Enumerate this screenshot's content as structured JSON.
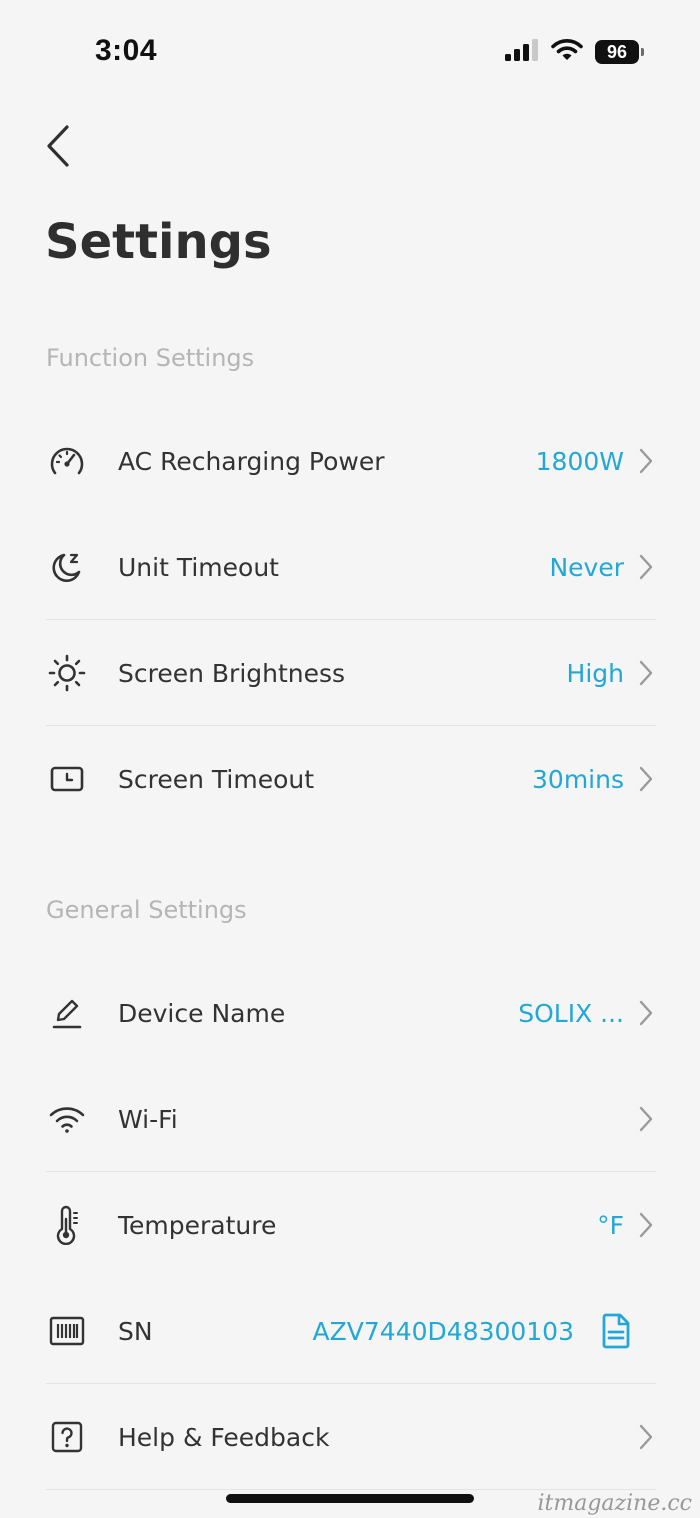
{
  "status_bar": {
    "time": "3:04",
    "battery_level": "96",
    "icons": [
      "cellular-signal-icon",
      "wifi-icon",
      "battery-icon"
    ]
  },
  "navigation": {
    "back_icon": "chevron-left-icon"
  },
  "page": {
    "title": "Settings"
  },
  "function_settings": {
    "header": "Function Settings",
    "items": [
      {
        "icon": "speedometer-icon",
        "label": "AC Recharging Power",
        "value": "1800W"
      },
      {
        "icon": "moon-sleep-icon",
        "label": "Unit Timeout",
        "value": "Never"
      },
      {
        "icon": "sun-brightness-icon",
        "label": "Screen Brightness",
        "value": "High"
      },
      {
        "icon": "screen-timer-icon",
        "label": "Screen Timeout",
        "value": "30mins"
      }
    ]
  },
  "general_settings": {
    "header": "General Settings",
    "items": [
      {
        "icon": "pencil-edit-icon",
        "label": "Device Name",
        "value": "SOLIX ..."
      },
      {
        "icon": "wifi-icon",
        "label": "Wi-Fi",
        "value": ""
      },
      {
        "icon": "thermometer-icon",
        "label": "Temperature",
        "value": "°F"
      },
      {
        "icon": "barcode-icon",
        "label": "SN",
        "value": "AZV7440D48300103"
      },
      {
        "icon": "help-question-icon",
        "label": "Help & Feedback",
        "value": ""
      }
    ]
  },
  "watermark": "itmagazine.cc",
  "colors": {
    "accent": "#22a7d6",
    "text": "#333333",
    "section_header": "#b5b5b5",
    "background": "#f5f5f5",
    "divider": "#e4e4e4"
  }
}
